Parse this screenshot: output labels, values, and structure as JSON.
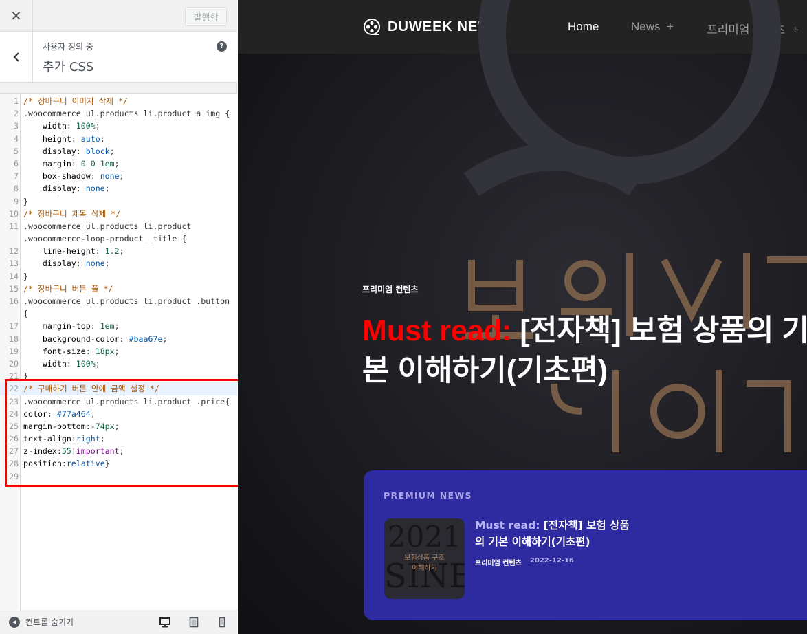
{
  "customizer": {
    "publish_label": "발행함",
    "crumb": "사용자 정의 중",
    "section_title": "추가 CSS",
    "hide_controls_label": "컨트롤 숨기기"
  },
  "code_lines": [
    {
      "n": "1",
      "parts": [
        {
          "c": "c-com",
          "t": "/* 장바구니 이미지 삭제 */"
        }
      ]
    },
    {
      "n": "2",
      "parts": [
        {
          "c": "c-sel",
          "t": ".woocommerce ul.products li.product a img {"
        }
      ]
    },
    {
      "n": "3",
      "parts": [
        {
          "c": "c-prop",
          "t": "    width"
        },
        {
          "c": "",
          "t": ": "
        },
        {
          "c": "c-num",
          "t": "100%"
        },
        {
          "c": "",
          "t": ";"
        }
      ]
    },
    {
      "n": "4",
      "parts": [
        {
          "c": "c-prop",
          "t": "    height"
        },
        {
          "c": "",
          "t": ": "
        },
        {
          "c": "c-val",
          "t": "auto"
        },
        {
          "c": "",
          "t": ";"
        }
      ]
    },
    {
      "n": "5",
      "parts": [
        {
          "c": "c-prop",
          "t": "    display"
        },
        {
          "c": "",
          "t": ": "
        },
        {
          "c": "c-val",
          "t": "block"
        },
        {
          "c": "",
          "t": ";"
        }
      ]
    },
    {
      "n": "6",
      "parts": [
        {
          "c": "c-prop",
          "t": "    margin"
        },
        {
          "c": "",
          "t": ": "
        },
        {
          "c": "c-num",
          "t": "0 0 1em"
        },
        {
          "c": "",
          "t": ";"
        }
      ]
    },
    {
      "n": "7",
      "parts": [
        {
          "c": "c-prop",
          "t": "    box-shadow"
        },
        {
          "c": "",
          "t": ": "
        },
        {
          "c": "c-val",
          "t": "none"
        },
        {
          "c": "",
          "t": ";"
        }
      ]
    },
    {
      "n": "8",
      "parts": [
        {
          "c": "c-prop",
          "t": "    display"
        },
        {
          "c": "",
          "t": ": "
        },
        {
          "c": "c-val",
          "t": "none"
        },
        {
          "c": "",
          "t": ";"
        }
      ]
    },
    {
      "n": "9",
      "parts": [
        {
          "c": "",
          "t": "}"
        }
      ]
    },
    {
      "n": "10",
      "parts": [
        {
          "c": "c-com",
          "t": "/* 장바구니 제목 삭제 */"
        }
      ]
    },
    {
      "n": "11",
      "parts": [
        {
          "c": "c-sel",
          "t": ".woocommerce ul.products li.product"
        }
      ]
    },
    {
      "n": "",
      "parts": [
        {
          "c": "c-sel",
          "t": ".woocommerce-loop-product__title {"
        }
      ]
    },
    {
      "n": "12",
      "parts": [
        {
          "c": "c-prop",
          "t": "    line-height"
        },
        {
          "c": "",
          "t": ": "
        },
        {
          "c": "c-num",
          "t": "1.2"
        },
        {
          "c": "",
          "t": ";"
        }
      ]
    },
    {
      "n": "13",
      "parts": [
        {
          "c": "c-prop",
          "t": "    display"
        },
        {
          "c": "",
          "t": ": "
        },
        {
          "c": "c-val",
          "t": "none"
        },
        {
          "c": "",
          "t": ";"
        }
      ]
    },
    {
      "n": "14",
      "parts": [
        {
          "c": "",
          "t": "}"
        }
      ]
    },
    {
      "n": "15",
      "parts": [
        {
          "c": "c-com",
          "t": "/* 장바구니 버튼 풀 */"
        }
      ]
    },
    {
      "n": "16",
      "parts": [
        {
          "c": "c-sel",
          "t": ".woocommerce ul.products li.product .button"
        }
      ]
    },
    {
      "n": "",
      "parts": [
        {
          "c": "",
          "t": "{"
        }
      ]
    },
    {
      "n": "17",
      "parts": [
        {
          "c": "c-prop",
          "t": "    margin-top"
        },
        {
          "c": "",
          "t": ": "
        },
        {
          "c": "c-num",
          "t": "1em"
        },
        {
          "c": "",
          "t": ";"
        }
      ]
    },
    {
      "n": "18",
      "parts": [
        {
          "c": "c-prop",
          "t": "    background-color"
        },
        {
          "c": "",
          "t": ": "
        },
        {
          "c": "c-val",
          "t": "#baa67e"
        },
        {
          "c": "",
          "t": ";"
        }
      ]
    },
    {
      "n": "19",
      "parts": [
        {
          "c": "c-prop",
          "t": "    font-size"
        },
        {
          "c": "",
          "t": ": "
        },
        {
          "c": "c-num",
          "t": "18px"
        },
        {
          "c": "",
          "t": ";"
        }
      ]
    },
    {
      "n": "20",
      "parts": [
        {
          "c": "c-prop",
          "t": "    width"
        },
        {
          "c": "",
          "t": ": "
        },
        {
          "c": "c-num",
          "t": "100%"
        },
        {
          "c": "",
          "t": ";"
        }
      ]
    },
    {
      "n": "21",
      "parts": [
        {
          "c": "",
          "t": "}"
        }
      ]
    },
    {
      "n": "22",
      "active": true,
      "parts": [
        {
          "c": "c-com",
          "t": "/* 구매하기 버튼 안에 금액 설정 */"
        }
      ]
    },
    {
      "n": "23",
      "parts": [
        {
          "c": "c-sel",
          "t": ".woocommerce ul.products li.product .price{"
        }
      ]
    },
    {
      "n": "24",
      "parts": [
        {
          "c": "c-prop",
          "t": "color"
        },
        {
          "c": "",
          "t": ": "
        },
        {
          "c": "c-val",
          "t": "#77a464"
        },
        {
          "c": "",
          "t": ";"
        }
      ]
    },
    {
      "n": "25",
      "parts": [
        {
          "c": "c-prop",
          "t": "margin-bottom"
        },
        {
          "c": "",
          "t": ":"
        },
        {
          "c": "c-num",
          "t": "-74px"
        },
        {
          "c": "",
          "t": ";"
        }
      ]
    },
    {
      "n": "26",
      "parts": [
        {
          "c": "c-prop",
          "t": "text-align"
        },
        {
          "c": "",
          "t": ":"
        },
        {
          "c": "c-val",
          "t": "right"
        },
        {
          "c": "",
          "t": ";"
        }
      ]
    },
    {
      "n": "27",
      "parts": [
        {
          "c": "c-prop",
          "t": "z-index"
        },
        {
          "c": "",
          "t": ":"
        },
        {
          "c": "c-num",
          "t": "55"
        },
        {
          "c": "c-kw",
          "t": "!important"
        },
        {
          "c": "",
          "t": ";"
        }
      ]
    },
    {
      "n": "28",
      "parts": [
        {
          "c": "c-prop",
          "t": "position"
        },
        {
          "c": "",
          "t": ":"
        },
        {
          "c": "c-val",
          "t": "relative"
        },
        {
          "c": "",
          "t": "}"
        }
      ]
    },
    {
      "n": "29",
      "parts": [
        {
          "c": "",
          "t": ""
        }
      ]
    }
  ],
  "site": {
    "logo_text": "DUWEEK NEWS",
    "nav": {
      "home": "Home",
      "news": "News  +",
      "premium": "프리미엄 콘텐츠  +"
    },
    "hero": {
      "category": "프리미엄 컨텐츠",
      "must_read": "Must read:",
      "title_line1": " [전자책] 보험 상품의 기",
      "title_line2": "본 이해하기(기초편)"
    },
    "card": {
      "kicker": "PREMIUM NEWS",
      "thumb_year": "2021",
      "thumb_word": "SINE",
      "thumb_line1": "보험상품 구조",
      "thumb_line2": "이해하기",
      "must_read": "Must read:",
      "title": " [전자책] 보험 상품의 기본 이해하기(기초편)",
      "category": "프리미엄 컨텐츠",
      "date": "2022-12-16"
    }
  },
  "colors": {
    "accent_red": "#ff0000",
    "card_bg": "#2e2aa0",
    "nav_bg": "#232323"
  },
  "icons": [
    "close-icon",
    "chevron-left-icon",
    "help-icon",
    "collapse-icon",
    "desktop-icon",
    "tablet-icon",
    "mobile-icon",
    "film-reel-logo-icon"
  ]
}
